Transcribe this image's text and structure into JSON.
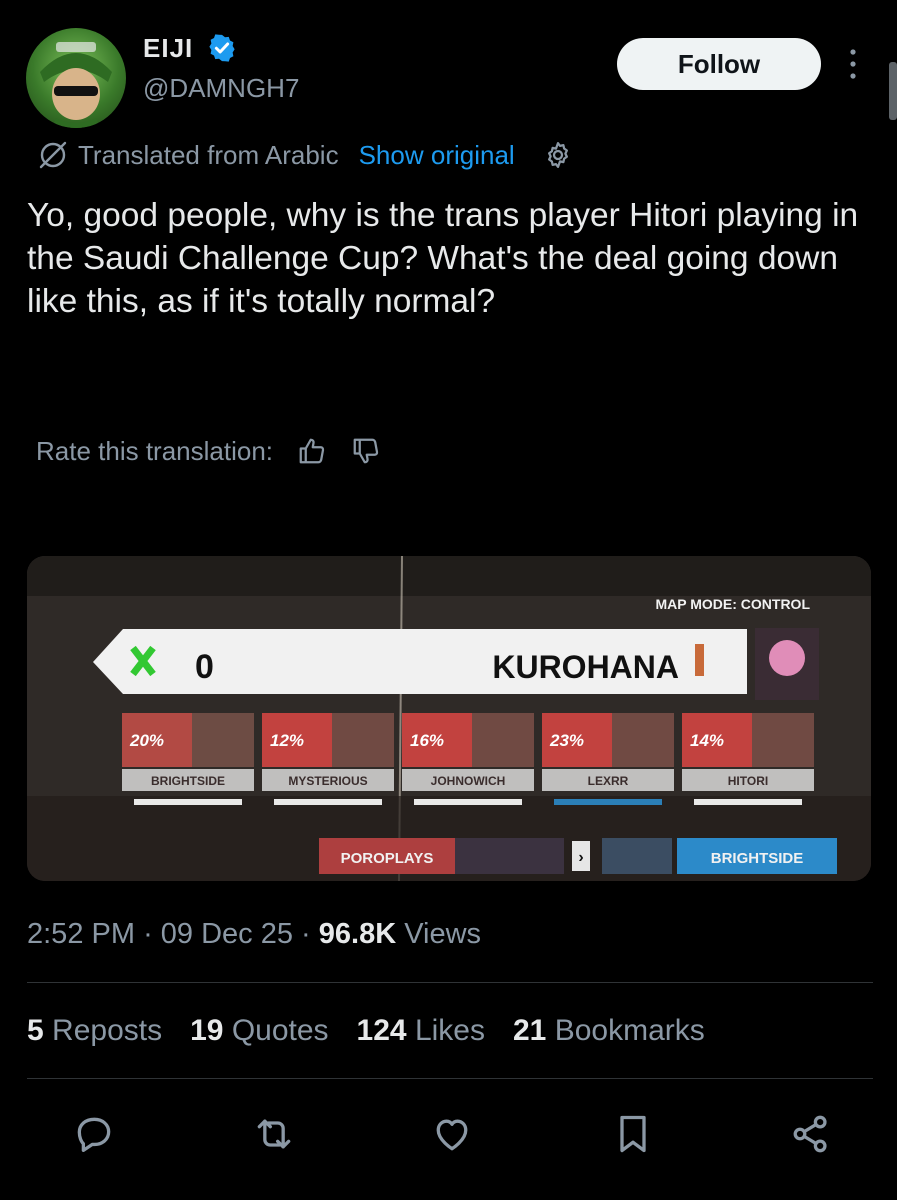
{
  "user": {
    "name": "EIJI",
    "handle": "@DAMNGH7",
    "verified": true
  },
  "follow_label": "Follow",
  "translation": {
    "label": "Translated from Arabic",
    "show_original": "Show original"
  },
  "tweet_text": "Yo, good people, why is the trans player Hitori playing in the Saudi Challenge Cup? What's the deal going down like this, as if it's totally normal?",
  "rate_label": "Rate this translation:",
  "media": {
    "map_mode": "MAP MODE: CONTROL",
    "score": "0",
    "team_name": "KUROHANA",
    "players": [
      {
        "pct": "20%",
        "name": "BRIGHTSIDE"
      },
      {
        "pct": "12%",
        "name": "MYSTERIOUS"
      },
      {
        "pct": "16%",
        "name": "JOHNOWICH"
      },
      {
        "pct": "23%",
        "name": "LEXRR"
      },
      {
        "pct": "14%",
        "name": "HITORI"
      }
    ],
    "killfeed_left": "POROPLAYS",
    "killfeed_right": "BRIGHTSIDE"
  },
  "meta": {
    "time": "2:52 PM",
    "date": "09 Dec 25",
    "views_count": "96.8K",
    "views_label": "Views"
  },
  "stats": {
    "reposts_count": "5",
    "reposts_label": "Reposts",
    "quotes_count": "19",
    "quotes_label": "Quotes",
    "likes_count": "124",
    "likes_label": "Likes",
    "bookmarks_count": "21",
    "bookmarks_label": "Bookmarks"
  },
  "colors": {
    "accent": "#1d9bf0",
    "secondary_text": "#8b98a5",
    "background": "#000000"
  },
  "icons": [
    "verified-badge-icon",
    "more-icon",
    "translate-icon",
    "gear-icon",
    "thumbs-up-icon",
    "thumbs-down-icon",
    "reply-icon",
    "repost-icon",
    "like-icon",
    "bookmark-icon",
    "share-icon"
  ]
}
